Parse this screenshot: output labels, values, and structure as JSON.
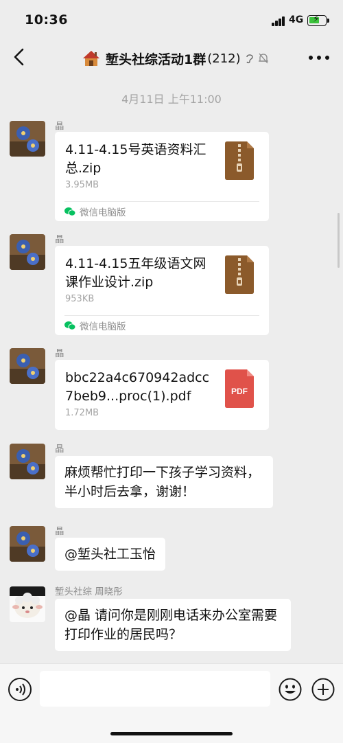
{
  "status": {
    "time": "10:36",
    "network": "4G"
  },
  "nav": {
    "title": "堑头社综活动1群",
    "count": "(212)"
  },
  "timestamp": "4月11日 上午11:00",
  "messages": [
    {
      "sender": "晶",
      "type": "file",
      "file_name": "4.11-4.15号英语资料汇总.zip",
      "file_size": "3.95MB",
      "source": "微信电脑版",
      "file_icon": "zip-file-icon"
    },
    {
      "sender": "晶",
      "type": "file",
      "file_name": "4.11-4.15五年级语文网课作业设计.zip",
      "file_size": "953KB",
      "source": "微信电脑版",
      "file_icon": "zip-file-icon"
    },
    {
      "sender": "晶",
      "type": "file",
      "file_name": "bbc22a4c670942adcc7beb9...proc(1).pdf",
      "file_size": "1.72MB",
      "file_icon": "pdf-file-icon",
      "icon_label": "PDF"
    },
    {
      "sender": "晶",
      "type": "text",
      "text": "麻烦帮忙打印一下孩子学习资料，半小时后去拿，谢谢！"
    },
    {
      "sender": "晶",
      "type": "text",
      "text": "@堑头社工玉怡"
    },
    {
      "sender": "堑头社综 周晓彤",
      "type": "text",
      "text": "@晶 请问你是刚刚电话来办公室需要打印作业的居民吗？"
    }
  ],
  "input": {
    "placeholder": ""
  },
  "colors": {
    "background": "#ededed",
    "bubble": "#ffffff",
    "zip": "#8b5a2b",
    "pdf": "#e0524a",
    "wechat_green": "#07c160"
  }
}
